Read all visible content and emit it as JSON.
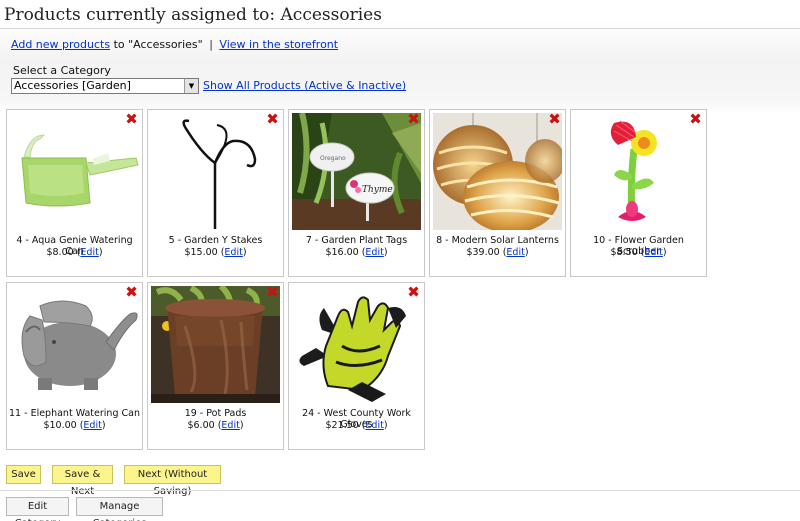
{
  "page_title": "Products currently assigned to: Accessories",
  "links": {
    "add_new": "Add new products",
    "to_text": " to \"Accessories\"",
    "separator": "|",
    "view_storefront": "View in the storefront"
  },
  "category": {
    "label": "Select a Category",
    "selected": "Accessories [Garden]",
    "show_all": "Show All Products (Active & Inactive)"
  },
  "delete_glyph": "✖",
  "products": [
    {
      "name": "4 - Aqua Genie Watering Can",
      "price": "$8.00",
      "edit": "Edit",
      "icon": "watering-can-image"
    },
    {
      "name": "5 - Garden Y Stakes",
      "price": "$15.00",
      "edit": "Edit",
      "icon": "garden-stake-image"
    },
    {
      "name": "7 - Garden Plant Tags",
      "price": "$16.00",
      "edit": "Edit",
      "icon": "plant-tags-image",
      "tag1": "Oregano",
      "tag2": "Thyme"
    },
    {
      "name": "8 - Modern Solar Lanterns",
      "price": "$39.00",
      "edit": "Edit",
      "icon": "lanterns-image"
    },
    {
      "name": "10 - Flower Garden Scrubber",
      "price": "$8.50",
      "edit": "Edit",
      "icon": "flower-scrubber-image"
    },
    {
      "name": "11 - Elephant Watering Can",
      "price": "$10.00",
      "edit": "Edit",
      "icon": "elephant-can-image"
    },
    {
      "name": "19 - Pot Pads",
      "price": "$6.00",
      "edit": "Edit",
      "icon": "pot-image"
    },
    {
      "name": "24 - West County Work Gloves",
      "price": "$21.50",
      "edit": "Edit",
      "icon": "gloves-image"
    }
  ],
  "buttons": {
    "save": "Save",
    "save_next": "Save & Next",
    "next_no_save": "Next (Without Saving)",
    "edit_category": "Edit Category",
    "manage_categories": "Manage Categories"
  }
}
